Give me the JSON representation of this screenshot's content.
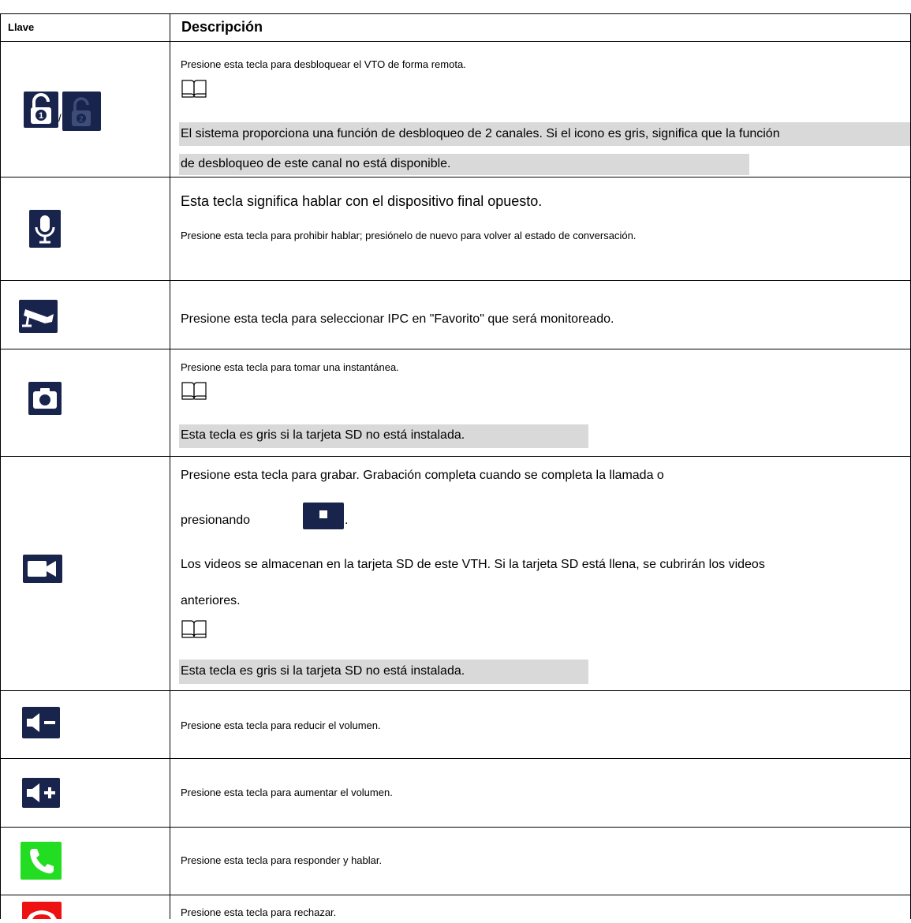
{
  "header": {
    "key_label": "Llave",
    "desc_label": "Descripción"
  },
  "rows": [
    {
      "icons": [
        "unlock-1-icon",
        "unlock-2-icon"
      ],
      "separator": "/",
      "line1": "Presione esta tecla para desbloquear el VTO de forma remota.",
      "note_line1": "El sistema proporciona una función de desbloqueo de 2 canales. Si el icono es gris, significa que la función",
      "note_line2": "de desbloqueo de este canal no está disponible."
    },
    {
      "icons": [
        "microphone-icon"
      ],
      "line1": "Esta tecla significa hablar con el dispositivo final opuesto.",
      "line2": "Presione esta tecla para prohibir hablar; presiónelo de nuevo para volver al estado de conversación."
    },
    {
      "icons": [
        "cctv-camera-icon"
      ],
      "line1": "Presione esta tecla para seleccionar IPC en \"Favorito\" que será monitoreado."
    },
    {
      "icons": [
        "camera-icon"
      ],
      "line1": "Presione esta tecla para tomar una instantánea.",
      "note_line1": "Esta tecla es gris si la tarjeta SD no está instalada."
    },
    {
      "icons": [
        "video-record-icon"
      ],
      "line1": "Presione esta tecla para grabar. Grabación completa cuando se completa la llamada o",
      "line2": "presionando",
      "line2_end": ".",
      "line3": "Los videos se almacenan en la tarjeta SD de este VTH. Si la tarjeta SD está llena, se cubrirán los videos",
      "line4": "anteriores.",
      "note_line1": "Esta tecla es gris si la tarjeta SD no está instalada."
    },
    {
      "icons": [
        "volume-down-icon"
      ],
      "line1": "Presione esta tecla para reducir el volumen."
    },
    {
      "icons": [
        "volume-up-icon"
      ],
      "line1": "Presione esta tecla para aumentar el volumen."
    },
    {
      "icons": [
        "answer-call-icon"
      ],
      "line1": "Presione esta tecla para responder y hablar."
    },
    {
      "icons": [
        "reject-call-icon"
      ],
      "line1": "Presione esta tecla para rechazar."
    }
  ],
  "colors": {
    "navy": "#19244d",
    "green": "#22dd22",
    "red": "#ee1111",
    "highlight": "#d9d9d9"
  }
}
